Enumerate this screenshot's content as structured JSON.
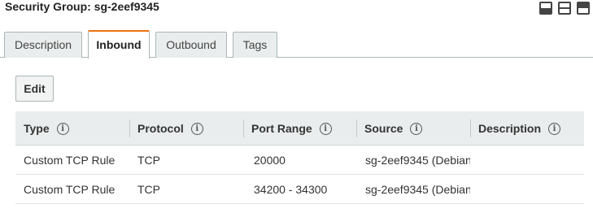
{
  "header": {
    "title": "Security Group: sg-2eef9345"
  },
  "tabs": [
    {
      "label": "Description",
      "active": false
    },
    {
      "label": "Inbound",
      "active": true
    },
    {
      "label": "Outbound",
      "active": false
    },
    {
      "label": "Tags",
      "active": false
    }
  ],
  "toolbar": {
    "edit_label": "Edit"
  },
  "table": {
    "columns": [
      {
        "label": "Type",
        "info_icon": "info-icon"
      },
      {
        "label": "Protocol",
        "info_icon": "info-icon"
      },
      {
        "label": "Port Range",
        "info_icon": "info-icon"
      },
      {
        "label": "Source",
        "info_icon": "info-icon"
      },
      {
        "label": "Description",
        "info_icon": "info-icon"
      }
    ],
    "rows": [
      {
        "type": "Custom TCP Rule",
        "protocol": "TCP",
        "port_range": "20000",
        "source": "sg-2eef9345 (Debian",
        "description": ""
      },
      {
        "type": "Custom TCP Rule",
        "protocol": "TCP",
        "port_range": "34200 - 34300",
        "source": "sg-2eef9345 (Debian",
        "description": ""
      }
    ]
  },
  "colors": {
    "active_tab_accent": "#ec7211",
    "table_header_bg": "#eaeded",
    "tab_bg": "#eaeded",
    "border": "#aab7b8"
  },
  "icons": {
    "info": "info-icon",
    "window_controls": [
      "panel-bottom-icon",
      "panel-split-icon",
      "panel-top-icon"
    ]
  }
}
